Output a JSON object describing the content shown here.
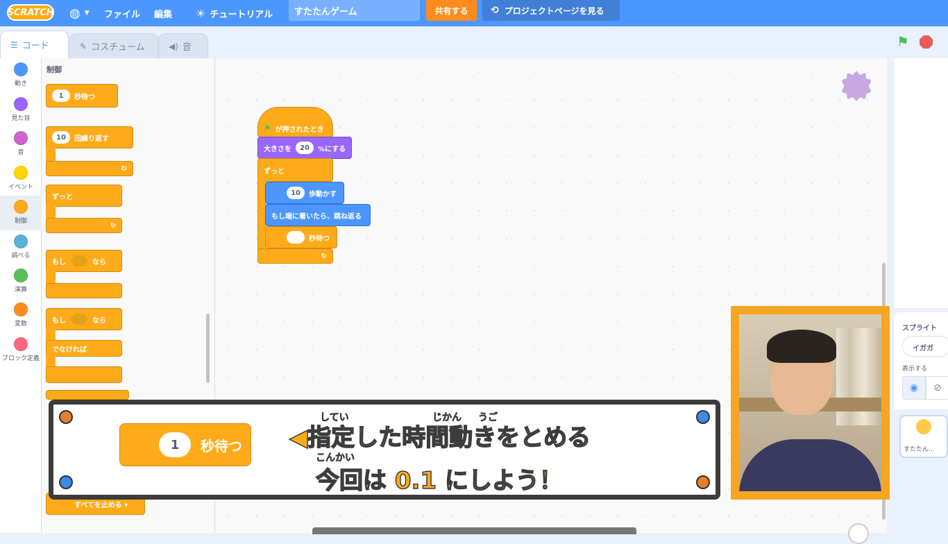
{
  "menubar": {
    "logo": "SCRATCH",
    "file": "ファイル",
    "edit": "編集",
    "tutorials": "チュートリアル",
    "project_title": "すたたんゲーム",
    "share": "共有する",
    "project_page": "プロジェクトページを見る"
  },
  "tabs": {
    "code": "コード",
    "costumes": "コスチューム",
    "sounds": "音"
  },
  "categories": [
    {
      "label": "動き",
      "color": "#4c97ff"
    },
    {
      "label": "見た目",
      "color": "#9966ff"
    },
    {
      "label": "音",
      "color": "#cf63cf"
    },
    {
      "label": "イベント",
      "color": "#ffd500"
    },
    {
      "label": "制御",
      "color": "#ffab19"
    },
    {
      "label": "調べる",
      "color": "#5cb1d6"
    },
    {
      "label": "演算",
      "color": "#59c059"
    },
    {
      "label": "変数",
      "color": "#ff8c1a"
    },
    {
      "label": "ブロック定義",
      "color": "#ff6680"
    }
  ],
  "palette": {
    "heading": "制御",
    "wait_value": "1",
    "wait_label": "秒待つ",
    "repeat_value": "10",
    "repeat_label": "回繰り返す",
    "forever_label": "ずっと",
    "if_label": "もし",
    "then_label": "なら",
    "if2_label": "もし",
    "then2_label": "なら",
    "else_label": "でなければ",
    "stop_label": "すべてを止める ▾"
  },
  "script": {
    "flag_label": "が押されたとき",
    "size_pre": "大きさを",
    "size_value": "20",
    "size_post": "%にする",
    "forever_label": "ずっと",
    "move_value": "10",
    "move_label": "歩動かす",
    "bounce_label": "もし端に着いたら、跳ね返る",
    "wait_value": "",
    "wait_label": "秒待つ"
  },
  "sprite_pane": {
    "sprite_label": "スプライト",
    "sprite_name": "イガガ",
    "show_label": "表示する",
    "thumb_name": "すたたん..."
  },
  "overlay": {
    "block_value": "1",
    "block_label": "秒待つ",
    "line1": "◀指定した時間動きをとめる",
    "line2": "今回は 0.1 にしよう！",
    "ruby_shitei": "してい",
    "ruby_jikan": "じかん",
    "ruby_ugo": "うご",
    "ruby_konkai": "こんかい"
  }
}
